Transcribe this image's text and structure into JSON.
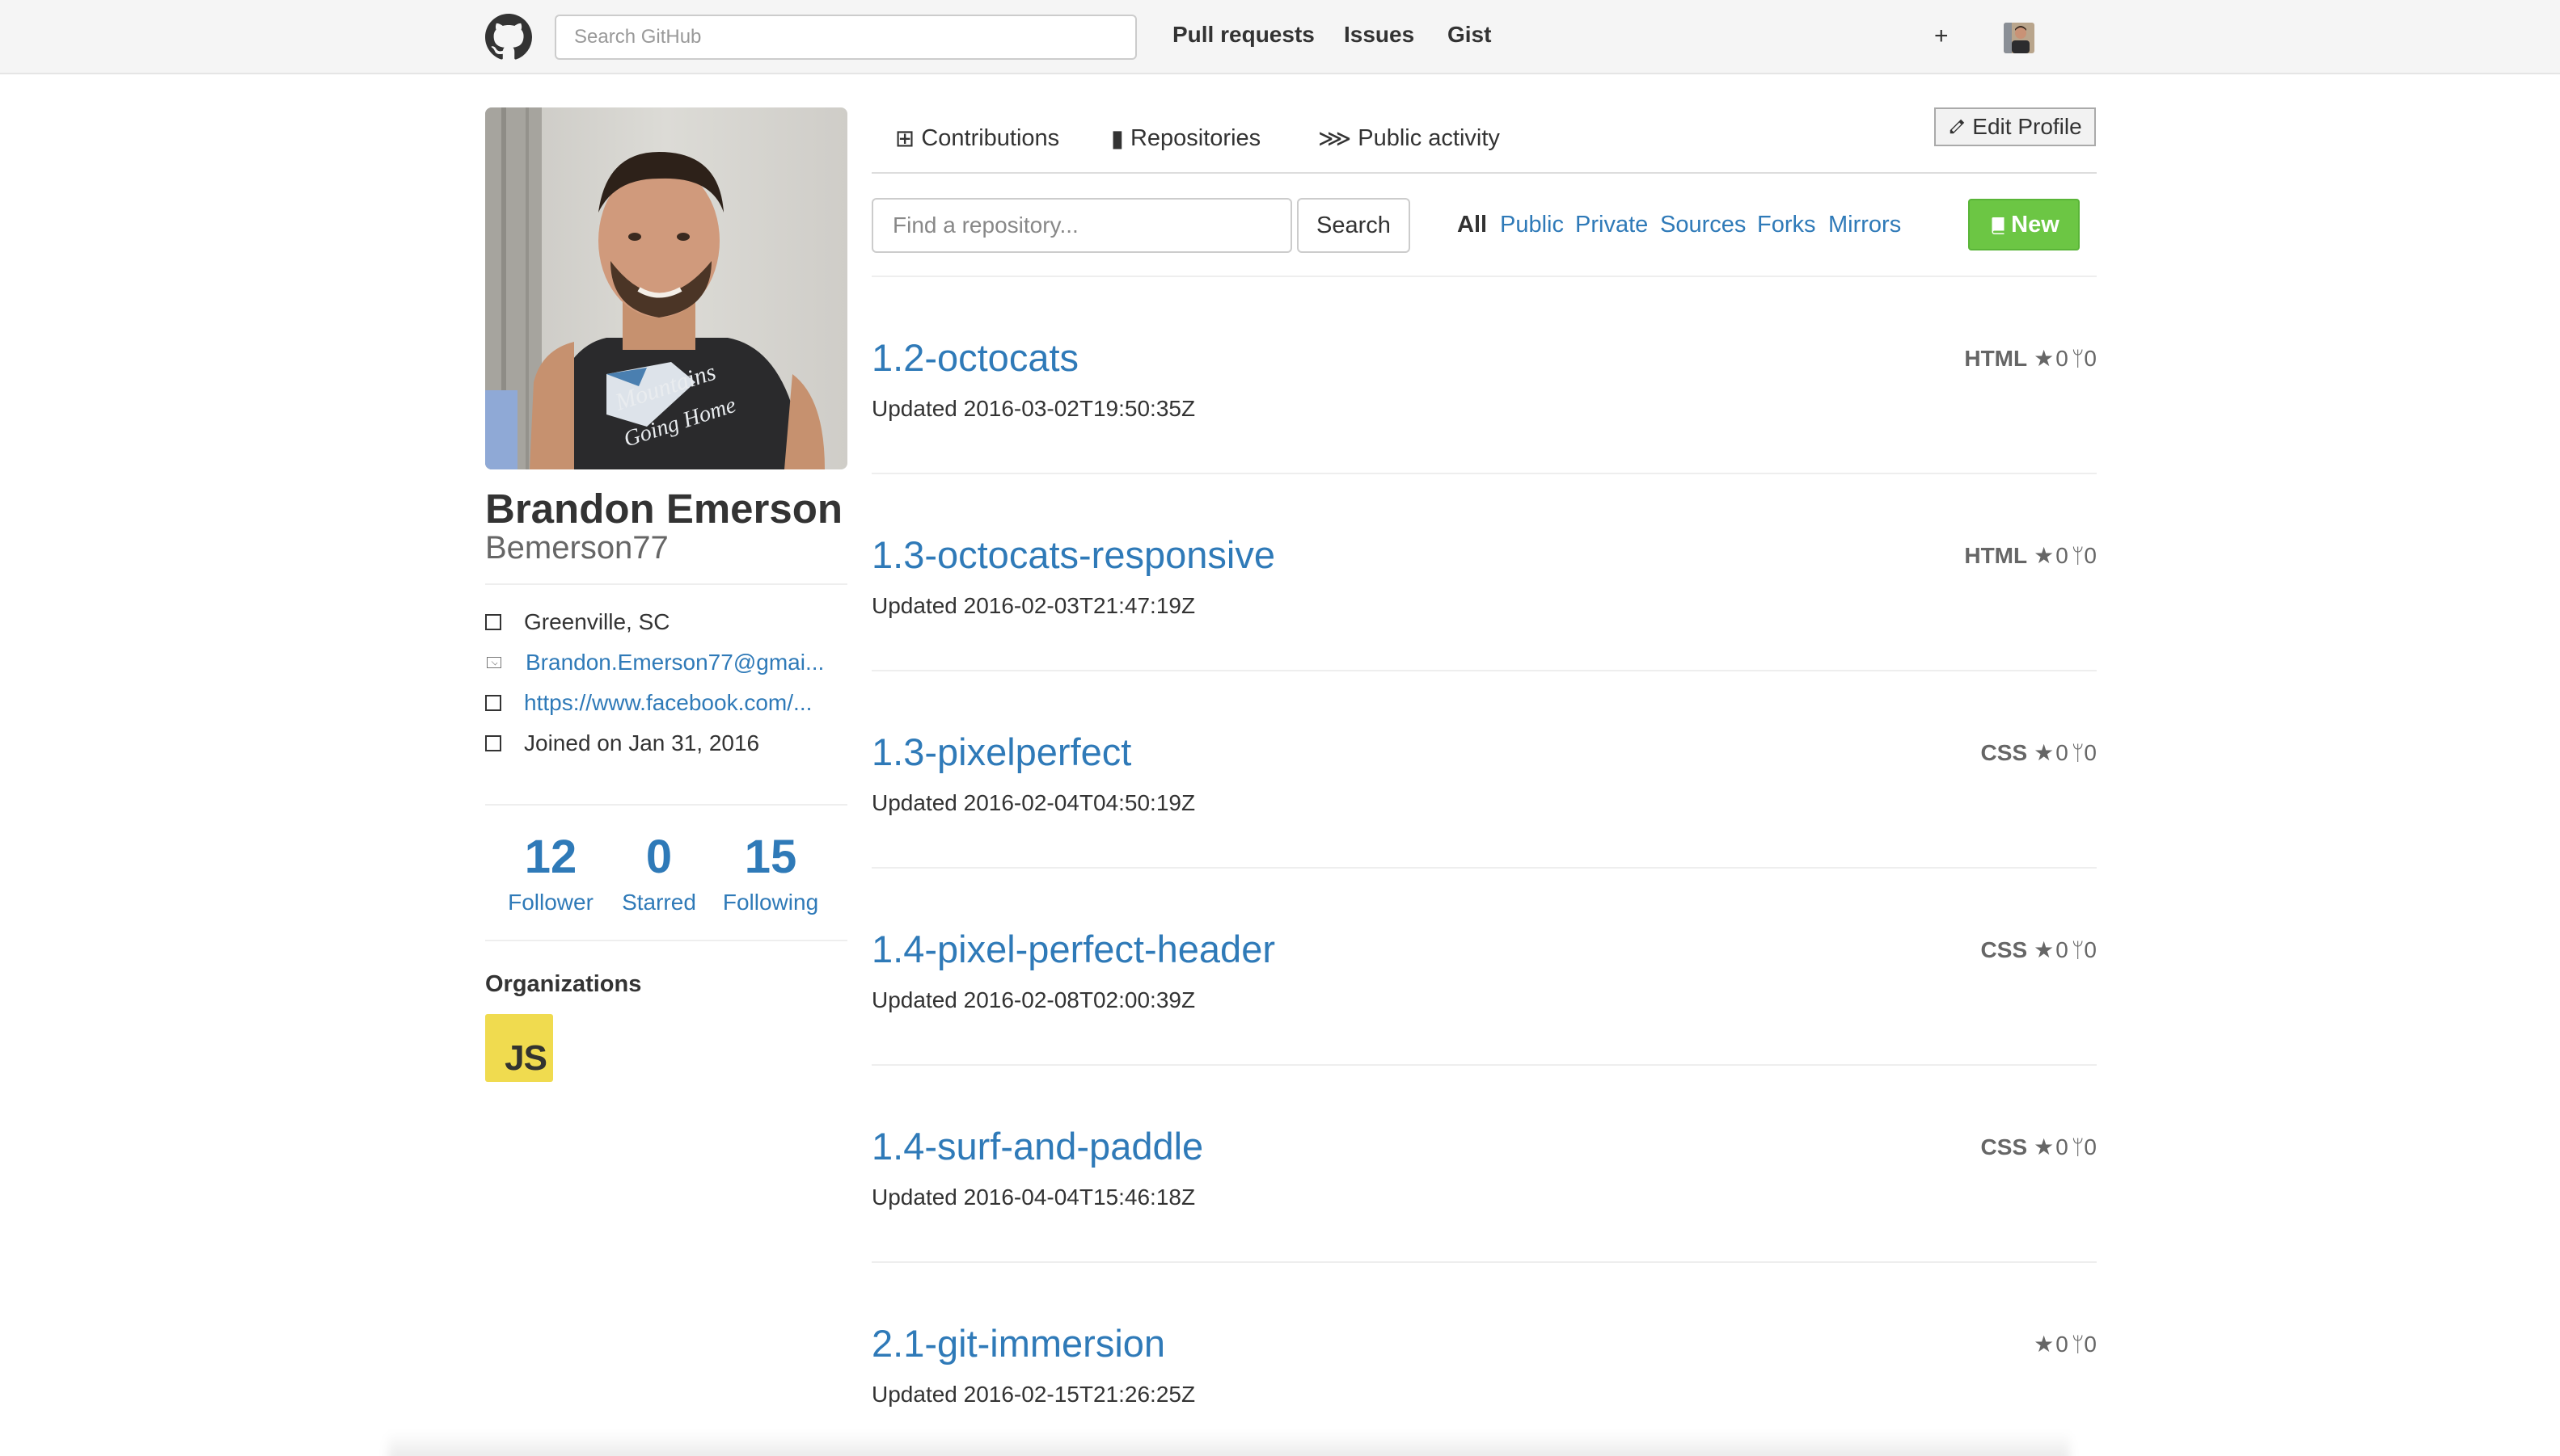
{
  "header": {
    "search_placeholder": "Search GitHub",
    "nav": [
      "Pull requests",
      "Issues",
      "Gist"
    ],
    "plus_label": "+"
  },
  "profile": {
    "full_name": "Brandon Emerson",
    "username": "Bemerson77",
    "details": [
      {
        "icon": "location-icon",
        "text": "Greenville, SC",
        "is_link": false
      },
      {
        "icon": "mail-icon",
        "text": "Brandon.Emerson77@gmai...",
        "is_link": true
      },
      {
        "icon": "link-icon",
        "text": "https://www.facebook.com/...",
        "is_link": true
      },
      {
        "icon": "clock-icon",
        "text": "Joined on Jan 31, 2016",
        "is_link": false
      }
    ],
    "stats": [
      {
        "value": "12",
        "label": "Follower"
      },
      {
        "value": "0",
        "label": "Starred"
      },
      {
        "value": "15",
        "label": "Following"
      }
    ],
    "organizations_heading": "Organizations",
    "org_logo_text": "JS"
  },
  "tabs": [
    {
      "icon": "⊞",
      "label": "Contributions"
    },
    {
      "icon": "▮",
      "label": "Repositories"
    },
    {
      "icon": "⋙",
      "label": "Public activity"
    }
  ],
  "edit_profile_label": "Edit Profile",
  "repo_filter": {
    "search_placeholder": "Find a repository...",
    "search_button": "Search",
    "filters": [
      "All",
      "Public",
      "Private",
      "Sources",
      "Forks",
      "Mirrors"
    ],
    "active_filter": "All",
    "new_button": "New"
  },
  "repositories": [
    {
      "name": "1.2-octocats",
      "updated": "Updated 2016-03-02T19:50:35Z",
      "language": "HTML",
      "stars": "0",
      "forks": "0"
    },
    {
      "name": "1.3-octocats-responsive",
      "updated": "Updated 2016-02-03T21:47:19Z",
      "language": "HTML",
      "stars": "0",
      "forks": "0"
    },
    {
      "name": "1.3-pixelperfect",
      "updated": "Updated 2016-02-04T04:50:19Z",
      "language": "CSS",
      "stars": "0",
      "forks": "0"
    },
    {
      "name": "1.4-pixel-perfect-header",
      "updated": "Updated 2016-02-08T02:00:39Z",
      "language": "CSS",
      "stars": "0",
      "forks": "0"
    },
    {
      "name": "1.4-surf-and-paddle",
      "updated": "Updated 2016-04-04T15:46:18Z",
      "language": "CSS",
      "stars": "0",
      "forks": "0"
    },
    {
      "name": "2.1-git-immersion",
      "updated": "Updated 2016-02-15T21:26:25Z",
      "language": "",
      "stars": "0",
      "forks": "0"
    }
  ],
  "colors": {
    "link": "#2f7ab8",
    "new_button": "#6cc644",
    "header_bg": "#f5f5f5",
    "js_logo": "#f0db4f"
  }
}
